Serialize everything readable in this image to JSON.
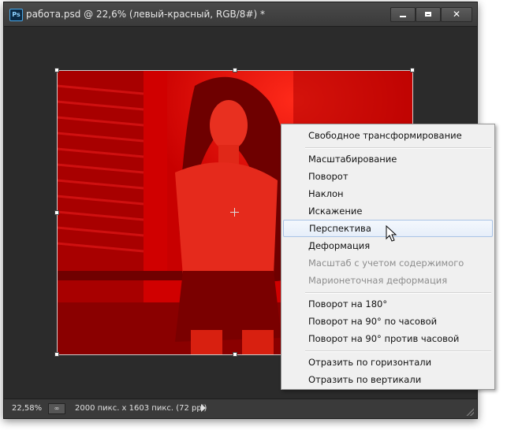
{
  "window": {
    "app_icon": "Ps",
    "title": "работа.psd @ 22,6% (левый-красный, RGB/8#) *",
    "buttons": {
      "minimize": "minimize-icon",
      "maximize": "maximize-icon",
      "close": "close-icon"
    }
  },
  "canvas": {
    "photo": "red-channel portrait photo",
    "accent_color": "#e00000",
    "background": "#2b2b2b"
  },
  "statusbar": {
    "zoom": "22,58%",
    "icon": "∞",
    "doc_info": "2000 пикс. x 1603 пикс. (72 ppi)"
  },
  "context_menu": {
    "items": [
      {
        "label": "Свободное трансформирование",
        "disabled": false
      },
      {
        "label": "Масштабирование",
        "disabled": false
      },
      {
        "label": "Поворот",
        "disabled": false
      },
      {
        "label": "Наклон",
        "disabled": false
      },
      {
        "label": "Искажение",
        "disabled": false
      },
      {
        "label": "Перспектива",
        "disabled": false,
        "hover": true
      },
      {
        "label": "Деформация",
        "disabled": false
      },
      {
        "label": "Масштаб с учетом содержимого",
        "disabled": true
      },
      {
        "label": "Марионеточная деформация",
        "disabled": true
      },
      {
        "label": "Поворот на 180°",
        "disabled": false
      },
      {
        "label": "Поворот на 90° по часовой",
        "disabled": false
      },
      {
        "label": "Поворот на 90° против часовой",
        "disabled": false
      },
      {
        "label": "Отразить по горизонтали",
        "disabled": false
      },
      {
        "label": "Отразить по вертикали",
        "disabled": false
      }
    ]
  }
}
